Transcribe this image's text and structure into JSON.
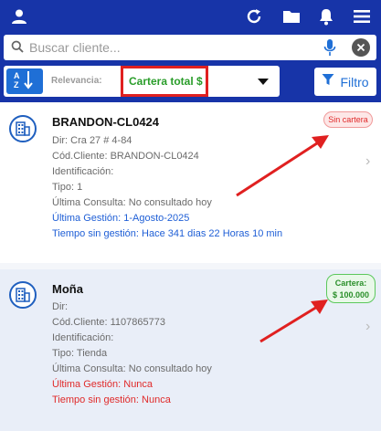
{
  "topbar": {
    "icons": [
      "user-icon",
      "refresh-icon",
      "folder-icon",
      "bell-icon",
      "menu-icon"
    ]
  },
  "search": {
    "placeholder": "Buscar cliente..."
  },
  "filters": {
    "relevance_label": "Relevancia:",
    "sort_selected": "Cartera total $",
    "filter_button": "Filtro"
  },
  "colors": {
    "primary": "#1734a8",
    "accent_blue": "#1f6fd6",
    "green": "#2a9d2a",
    "red": "#e02020"
  },
  "clients": [
    {
      "name": "BRANDON-CL0424",
      "badge": "Sin cartera",
      "dir": "Dir: Cra 27 # 4-84",
      "cod": "Cód.Cliente: BRANDON-CL0424",
      "ident": "Identificación:",
      "tipo": "Tipo: 1",
      "ultima_consulta": "Última Consulta: No consultado hoy",
      "ultima_gestion": "Última Gestión: 1-Agosto-2025",
      "tiempo_sin_gestion": "Tiempo sin gestión: Hace 341 dias 22 Horas 10 min"
    },
    {
      "name": "Moña",
      "badge_line1": "Cartera:",
      "badge_line2": "$ 100.000",
      "dir": "Dir:",
      "cod": "Cód.Cliente: 1107865773",
      "ident": "Identificación:",
      "tipo": "Tipo: Tienda",
      "ultima_consulta": "Última Consulta: No consultado hoy",
      "ultima_gestion": "Última Gestión: Nunca",
      "tiempo_sin_gestion": "Tiempo sin gestión: Nunca"
    }
  ]
}
